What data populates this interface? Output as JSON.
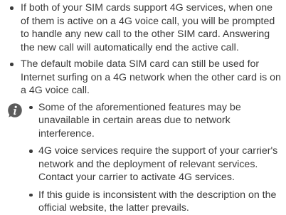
{
  "bullets": [
    "If both of your SIM cards support 4G services, when one of them is active on a 4G voice call, you will be prompted to handle any new call to the other SIM card. Answering the new call will automatically end the active call.",
    "The default mobile data SIM card can still be used for Internet surfing on a 4G network when the other card is on a 4G voice call."
  ],
  "note": {
    "icon": "info-icon",
    "items": [
      "Some of the aforementioned features may be unavailable in certain areas due to network interference.",
      "4G voice services require the support of your carrier's network and the deployment of relevant services. Contact your carrier to activate 4G services.",
      "If this guide is inconsistent with the description on the official website, the latter prevails."
    ]
  }
}
